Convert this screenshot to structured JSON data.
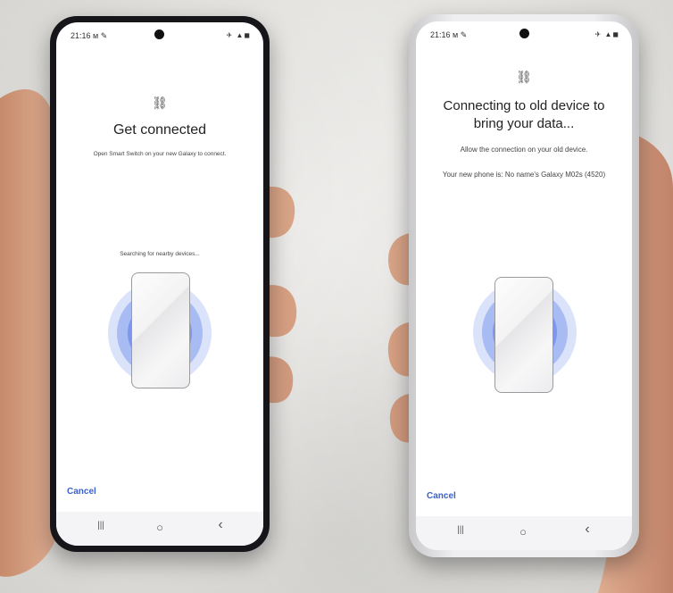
{
  "left_phone": {
    "status_time": "21:16 ᴍ ✎",
    "status_icons": "✈ ▲◼",
    "title": "Get connected",
    "subtitle": "Open Smart Switch on your new Galaxy to connect.",
    "searching": "Searching for nearby devices...",
    "cancel": "Cancel",
    "nav_recent": "|||",
    "nav_home": "○",
    "nav_back": "‹"
  },
  "right_phone": {
    "status_time": "21:16 ᴍ ✎",
    "status_icons": "✈ ▲◼",
    "title_line1": "Connecting to old device to",
    "title_line2": "bring your data...",
    "subtitle": "Allow the connection on your old device.",
    "phone_info": "Your new phone is: No name's Galaxy M02s (4520)",
    "cancel": "Cancel",
    "nav_recent": "|||",
    "nav_home": "○",
    "nav_back": "‹"
  },
  "icons": {
    "link": "⛓"
  },
  "colors": {
    "accent": "#3b5fc9",
    "ring_outer": "#dbe3fb",
    "ring_mid": "#a9bbf3",
    "ring_inner": "#7e97ea"
  }
}
